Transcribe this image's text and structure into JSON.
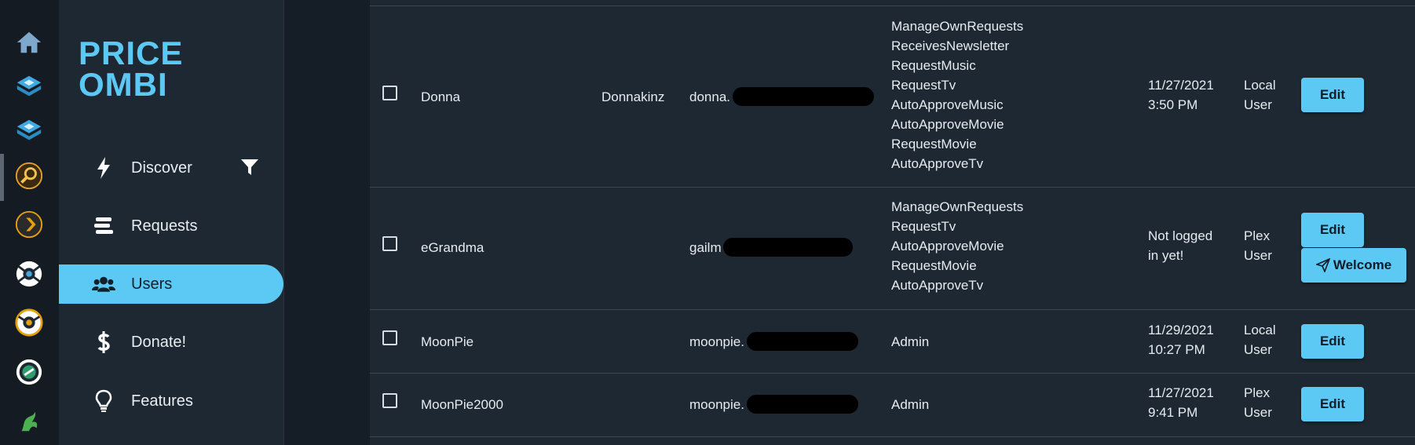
{
  "dock": {
    "icons": [
      "home-icon",
      "cube-icon",
      "cube-icon-2",
      "search-app-icon",
      "plex-icon",
      "app-icon-white",
      "app-icon-orange",
      "app-icon-green",
      "app-icon-dragon"
    ]
  },
  "brand": {
    "line1": "PRICE",
    "line2": "OMBI"
  },
  "nav": {
    "items": [
      {
        "label": "Discover",
        "icon": "lightning-icon"
      },
      {
        "label": "Requests",
        "icon": "list-icon"
      },
      {
        "label": "Users",
        "icon": "users-icon",
        "active": true
      },
      {
        "label": "Donate!",
        "icon": "dollar-icon"
      },
      {
        "label": "Features",
        "icon": "lightbulb-icon"
      }
    ]
  },
  "users": [
    {
      "username": "Donna",
      "alias": "Donnakinz",
      "email": "donna.",
      "claims": [
        "ManageOwnRequests",
        "ReceivesNewsletter",
        "RequestMusic",
        "RequestTv",
        "AutoApproveMusic",
        "AutoApproveMovie",
        "RequestMovie",
        "AutoApproveTv"
      ],
      "last_login": [
        "11/27/2021",
        "3:50 PM"
      ],
      "user_type": [
        "Local",
        "User"
      ],
      "edit_label": "Edit"
    },
    {
      "username": "eGrandma",
      "alias": "",
      "email": "gailm",
      "claims": [
        "ManageOwnRequests",
        "RequestTv",
        "AutoApproveMovie",
        "RequestMovie",
        "AutoApproveTv"
      ],
      "last_login": [
        "Not logged",
        "in yet!"
      ],
      "user_type": [
        "Plex",
        "User"
      ],
      "edit_label": "Edit",
      "welcome_label": "Welcome"
    },
    {
      "username": "MoonPie",
      "alias": "",
      "email": "moonpie.",
      "claims": [
        "Admin"
      ],
      "last_login": [
        "11/29/2021",
        "10:27 PM"
      ],
      "user_type": [
        "Local",
        "User"
      ],
      "edit_label": "Edit"
    },
    {
      "username": "MoonPie2000",
      "alias": "",
      "email": "moonpie.",
      "claims": [
        "Admin"
      ],
      "last_login": [
        "11/27/2021",
        "9:41 PM"
      ],
      "user_type": [
        "Plex",
        "User"
      ],
      "edit_label": "Edit"
    }
  ],
  "colors": {
    "accent": "#5cc8f4",
    "background": "#1e2832",
    "dock": "#151b22"
  }
}
